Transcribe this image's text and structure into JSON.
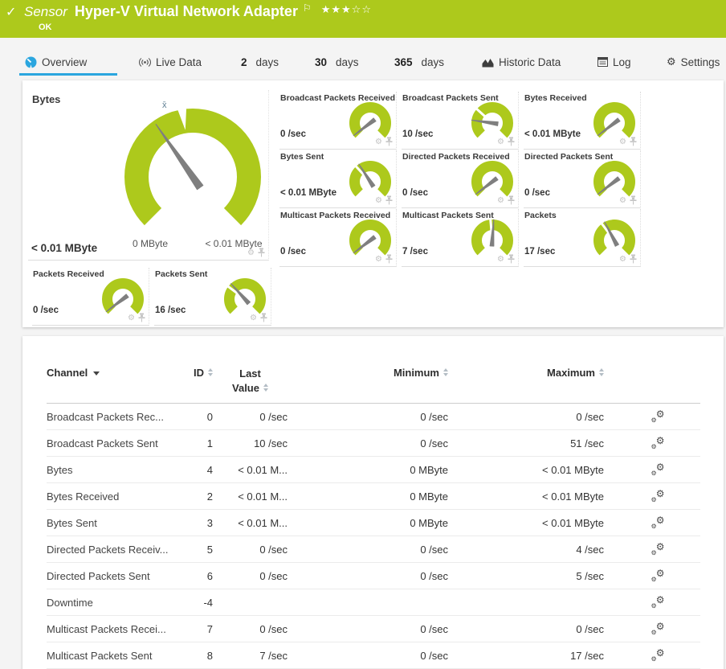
{
  "header": {
    "type_label": "Sensor",
    "title": "Hyper-V Virtual Network Adapter",
    "status": "OK",
    "rating_stars": "★★★☆☆"
  },
  "tabs": {
    "overview": "Overview",
    "live_data": "Live Data",
    "days2_num": "2",
    "days2_word": "days",
    "days30_num": "30",
    "days30_word": "days",
    "days365_num": "365",
    "days365_word": "days",
    "historic": "Historic Data",
    "log": "Log",
    "settings": "Settings"
  },
  "gauge_panel": {
    "main": {
      "title": "Bytes",
      "value": "< 0.01 MByte",
      "min_label": "0 MByte",
      "max_label": "< 0.01 MByte",
      "avg_symbol": "x̄",
      "needle_deg": -35,
      "marker_deg": -9
    },
    "small": [
      {
        "title": "Broadcast Packets Received",
        "value": "0 /sec",
        "needle_deg": -127,
        "marker_deg": null
      },
      {
        "title": "Broadcast Packets Sent",
        "value": "10 /sec",
        "needle_deg": -82,
        "marker_deg": -48
      },
      {
        "title": "Bytes Received",
        "value": "< 0.01 MByte",
        "needle_deg": -127,
        "marker_deg": null
      },
      {
        "title": "Bytes Sent",
        "value": "< 0.01 MByte",
        "needle_deg": -33,
        "marker_deg": -43
      },
      {
        "title": "Directed Packets Received",
        "value": "0 /sec",
        "needle_deg": -127,
        "marker_deg": null
      },
      {
        "title": "Directed Packets Sent",
        "value": "0 /sec",
        "needle_deg": -127,
        "marker_deg": null
      },
      {
        "title": "Multicast Packets Received",
        "value": "0 /sec",
        "needle_deg": -127,
        "marker_deg": null
      },
      {
        "title": "Multicast Packets Sent",
        "value": "7 /sec",
        "needle_deg": 4,
        "marker_deg": -5
      },
      {
        "title": "Packets",
        "value": "17 /sec",
        "needle_deg": -28,
        "marker_deg": -37
      },
      {
        "title": "Packets Received",
        "value": "0 /sec",
        "needle_deg": -127,
        "marker_deg": null
      },
      {
        "title": "Packets Sent",
        "value": "16 /sec",
        "needle_deg": -42,
        "marker_deg": -53
      }
    ]
  },
  "table": {
    "headers": {
      "channel": "Channel",
      "id": "ID",
      "last_value_line1": "Last",
      "last_value_line2": "Value",
      "minimum": "Minimum",
      "maximum": "Maximum"
    },
    "rows": [
      {
        "channel": "Broadcast Packets Rec...",
        "id": "0",
        "last": "0 /sec",
        "min": "0 /sec",
        "max": "0 /sec"
      },
      {
        "channel": "Broadcast Packets Sent",
        "id": "1",
        "last": "10 /sec",
        "min": "0 /sec",
        "max": "51 /sec"
      },
      {
        "channel": "Bytes",
        "id": "4",
        "last": "< 0.01 M...",
        "min": "0 MByte",
        "max": "< 0.01 MByte"
      },
      {
        "channel": "Bytes Received",
        "id": "2",
        "last": "< 0.01 M...",
        "min": "0 MByte",
        "max": "< 0.01 MByte"
      },
      {
        "channel": "Bytes Sent",
        "id": "3",
        "last": "< 0.01 M...",
        "min": "0 MByte",
        "max": "< 0.01 MByte"
      },
      {
        "channel": "Directed Packets Receiv...",
        "id": "5",
        "last": "0 /sec",
        "min": "0 /sec",
        "max": "4 /sec"
      },
      {
        "channel": "Directed Packets Sent",
        "id": "6",
        "last": "0 /sec",
        "min": "0 /sec",
        "max": "5 /sec"
      },
      {
        "channel": "Downtime",
        "id": "-4",
        "last": "",
        "min": "",
        "max": ""
      },
      {
        "channel": "Multicast Packets Recei...",
        "id": "7",
        "last": "0 /sec",
        "min": "0 /sec",
        "max": "0 /sec"
      },
      {
        "channel": "Multicast Packets Sent",
        "id": "8",
        "last": "7 /sec",
        "min": "0 /sec",
        "max": "17 /sec"
      }
    ]
  },
  "colors": {
    "brand_green": "#adc91c",
    "accent_blue": "#2ba6df",
    "needle_gray": "#7f7f7f"
  }
}
